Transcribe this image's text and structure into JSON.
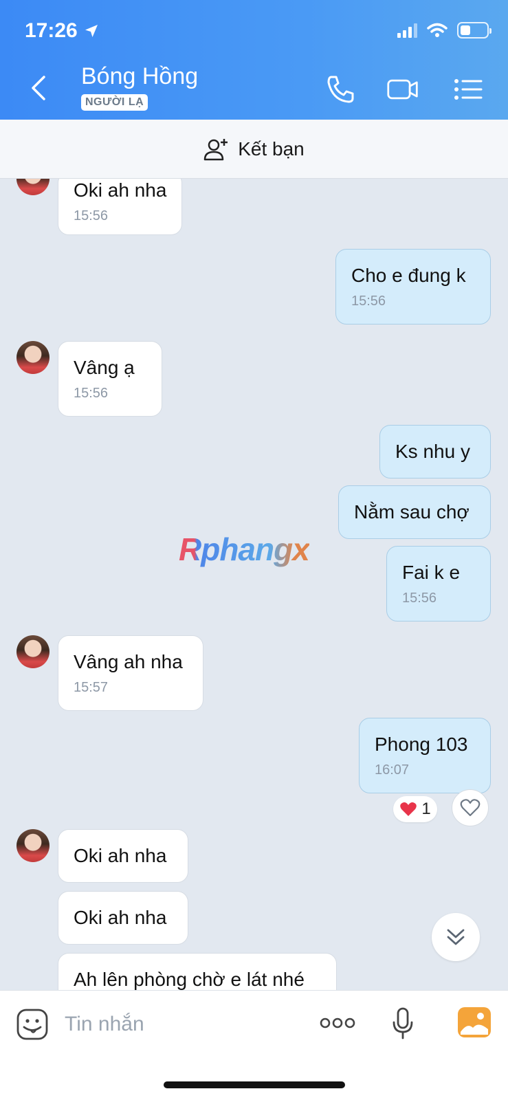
{
  "status_bar": {
    "time": "17:26"
  },
  "header": {
    "contact_name": "Bóng Hồng",
    "badge": "NGƯỜI LẠ"
  },
  "add_friend": {
    "label": "Kết bạn"
  },
  "messages": [
    {
      "text": "Oki ah nha",
      "time": "15:56"
    },
    {
      "text": "Cho e đung k",
      "time": "15:56"
    },
    {
      "text": "Vâng ạ",
      "time": "15:56"
    },
    {
      "text": "Ks nhu y"
    },
    {
      "text": "Nằm sau chợ"
    },
    {
      "text": "Fai k e",
      "time": "15:56"
    },
    {
      "text": "Vâng ah nha",
      "time": "15:57"
    },
    {
      "text": "Phong 103",
      "time": "16:07"
    },
    {
      "text": "Oki ah nha"
    },
    {
      "text": "Oki ah nha"
    },
    {
      "text": "Ah lên phòng chờ e lát nhé"
    }
  ],
  "reaction": {
    "count": "1"
  },
  "watermark": "Rphangx",
  "input": {
    "placeholder": "Tin nhắn"
  }
}
